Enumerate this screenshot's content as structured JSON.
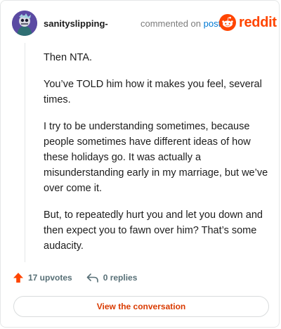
{
  "comment": {
    "username": "sanityslipping-",
    "action_text": "commented on",
    "post_link": "post",
    "brand": "reddit",
    "paragraphs": [
      "Then NTA.",
      "You’ve TOLD him how it makes you feel, several times.",
      "I try to be understanding sometimes, because people sometimes have different ideas of how these holidays go. It was actually a misunderstanding early in my marriage, but we’ve over come it.",
      "But, to repeatedly hurt you and let you down and then expect you to fawn over him? That’s some audacity."
    ],
    "upvotes": "17 upvotes",
    "replies": "0 replies",
    "view_button": "View the conversation"
  },
  "colors": {
    "brand": "#ff4500",
    "link": "#0079d3",
    "button_text": "#d93a00",
    "upvote": "#ff4500"
  },
  "icons": {
    "avatar": "avatar",
    "logo": "reddit-snoo-icon",
    "upvote": "upvote-arrow-icon",
    "reply": "reply-arrow-icon"
  }
}
